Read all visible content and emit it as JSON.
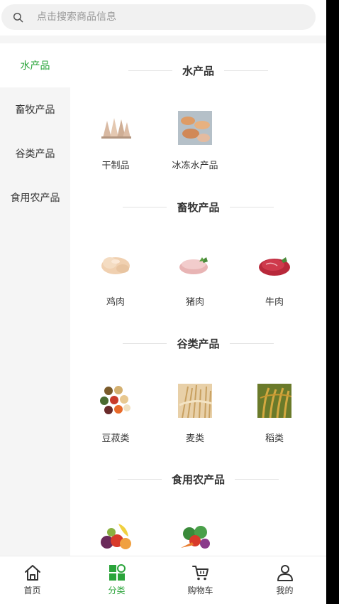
{
  "search": {
    "placeholder": "点击搜索商品信息"
  },
  "sidebar": {
    "items": [
      {
        "label": "水产品",
        "active": true
      },
      {
        "label": "畜牧产品",
        "active": false
      },
      {
        "label": "谷类产品",
        "active": false
      },
      {
        "label": "食用农产品",
        "active": false
      }
    ]
  },
  "sections": [
    {
      "title": "水产品",
      "products": [
        {
          "label": "干制品",
          "icon": "dried-squid-image"
        },
        {
          "label": "冰冻水产品",
          "icon": "frozen-seafood-image"
        }
      ]
    },
    {
      "title": "畜牧产品",
      "products": [
        {
          "label": "鸡肉",
          "icon": "chicken-image"
        },
        {
          "label": "猪肉",
          "icon": "pork-image"
        },
        {
          "label": "牛肉",
          "icon": "beef-image"
        }
      ]
    },
    {
      "title": "谷类产品",
      "products": [
        {
          "label": "豆菽类",
          "icon": "beans-image"
        },
        {
          "label": "麦类",
          "icon": "wheat-image"
        },
        {
          "label": "稻类",
          "icon": "rice-image"
        }
      ]
    },
    {
      "title": "食用农产品",
      "products": [
        {
          "label": "",
          "icon": "fruit-image"
        },
        {
          "label": "",
          "icon": "vegetables-image"
        }
      ]
    }
  ],
  "tabbar": {
    "items": [
      {
        "label": "首页",
        "icon": "home-icon",
        "active": false
      },
      {
        "label": "分类",
        "icon": "category-icon",
        "active": true
      },
      {
        "label": "购物车",
        "icon": "cart-icon",
        "active": false
      },
      {
        "label": "我的",
        "icon": "profile-icon",
        "active": false
      }
    ]
  },
  "colors": {
    "accent": "#2aa43a",
    "sidebar_bg": "#f5f5f5",
    "search_bg": "#f1f1f1",
    "text": "#333333"
  }
}
